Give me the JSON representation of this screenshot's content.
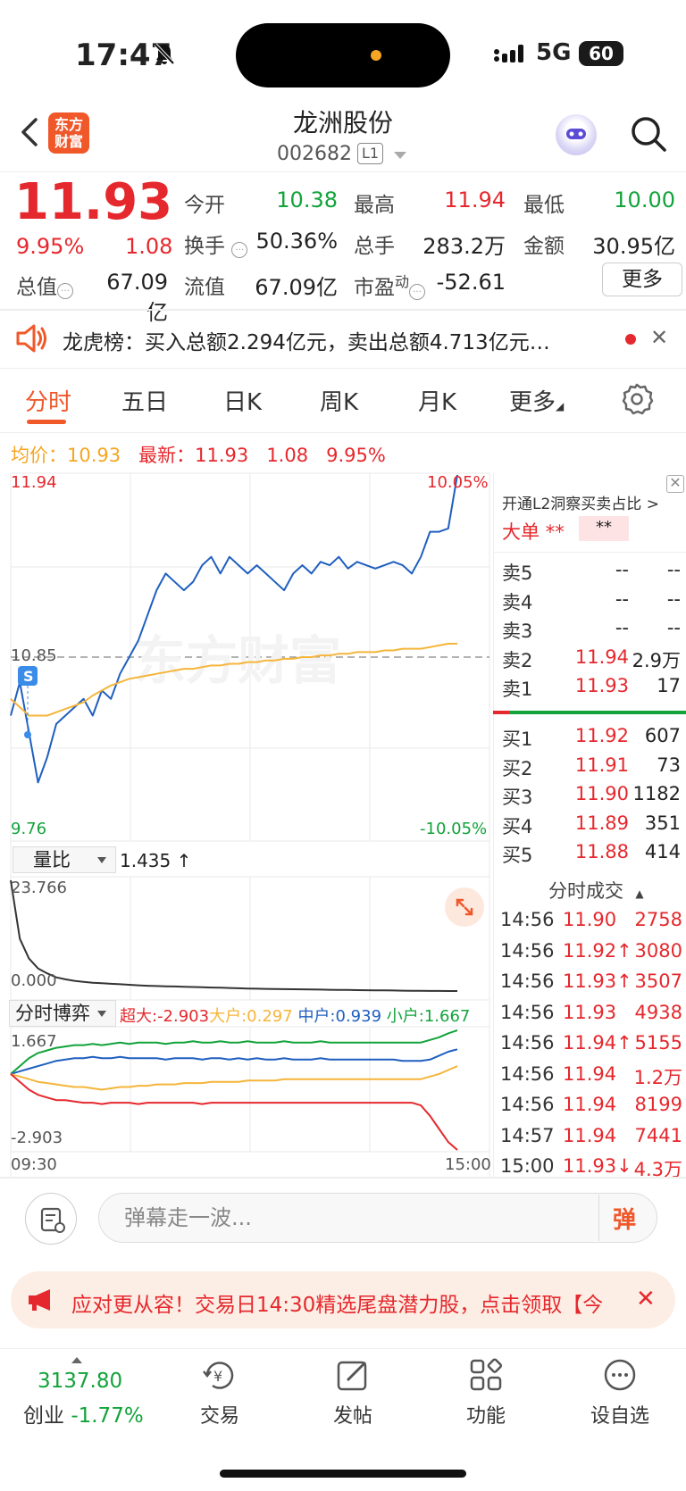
{
  "status": {
    "time": "17:47",
    "network": "5G",
    "battery": "60"
  },
  "header": {
    "logo": "东方\n财富",
    "title": "龙洲股份",
    "code": "002682",
    "level": "L1"
  },
  "quote": {
    "price": "11.93",
    "pct": "9.95%",
    "change": "1.08",
    "open_label": "今开",
    "open": "10.38",
    "high_label": "最高",
    "high": "11.94",
    "low_label": "最低",
    "low": "10.00",
    "turnover_label": "换手",
    "turnover": "50.36%",
    "volume_label": "总手",
    "volume": "283.2万",
    "amount_label": "金额",
    "amount": "30.95亿",
    "mktcap_label": "总值",
    "mktcap": "67.09亿",
    "float_label": "流值",
    "float": "67.09亿",
    "pe_label": "市盈",
    "pe_sup": "动",
    "pe": "-52.61",
    "more": "更多"
  },
  "news": {
    "text": "龙虎榜：买入总额2.294亿元，卖出总额4.713亿元…"
  },
  "tabs": [
    "分时",
    "五日",
    "日K",
    "周K",
    "月K",
    "更多"
  ],
  "chart_info": {
    "avg_label": "均价：",
    "avg": "10.93",
    "latest_label": "最新：",
    "latest": "11.93",
    "chg": "1.08",
    "pct": "9.95%"
  },
  "chart_data": [
    {
      "type": "line",
      "name": "intraday",
      "y_top": "11.94",
      "y_mid": "10.85",
      "y_bottom": "9.76",
      "pct_top": "10.05%",
      "pct_bottom": "-10.05%",
      "ylim": [
        9.76,
        11.94
      ],
      "series": [
        {
          "color": "#1f5fbf",
          "values": [
            10.5,
            10.7,
            10.4,
            10.1,
            10.25,
            10.45,
            10.5,
            10.55,
            10.6,
            10.5,
            10.65,
            10.6,
            10.75,
            10.85,
            10.95,
            11.1,
            11.25,
            11.35,
            11.3,
            11.25,
            11.3,
            11.4,
            11.45,
            11.35,
            11.45,
            11.4,
            11.35,
            11.4,
            11.35,
            11.3,
            11.25,
            11.35,
            11.4,
            11.35,
            11.42,
            11.4,
            11.45,
            11.38,
            11.42,
            11.4,
            11.38,
            11.4,
            11.42,
            11.4,
            11.35,
            11.45,
            11.6,
            11.6,
            11.62,
            11.94
          ]
        },
        {
          "color": "#f5b53a",
          "values": [
            10.6,
            10.55,
            10.5,
            10.5,
            10.5,
            10.52,
            10.54,
            10.56,
            10.58,
            10.62,
            10.65,
            10.68,
            10.7,
            10.72,
            10.73,
            10.74,
            10.75,
            10.76,
            10.77,
            10.78,
            10.78,
            10.79,
            10.8,
            10.8,
            10.81,
            10.81,
            10.82,
            10.82,
            10.83,
            10.83,
            10.84,
            10.84,
            10.85,
            10.85,
            10.86,
            10.86,
            10.87,
            10.87,
            10.88,
            10.88,
            10.88,
            10.89,
            10.89,
            10.9,
            10.9,
            10.9,
            10.91,
            10.92,
            10.93,
            10.93
          ]
        }
      ]
    },
    {
      "type": "line",
      "name": "volume_ratio",
      "label": "量比",
      "value": "1.435 ↑",
      "y_top": "23.766",
      "y_bottom": "0.000",
      "ylim": [
        0,
        23.766
      ],
      "series": [
        {
          "color": "#333333",
          "values": [
            23.766,
            12,
            8,
            6,
            5,
            4.2,
            3.8,
            3.5,
            3.3,
            3.1,
            3.0,
            2.9,
            2.8,
            2.7,
            2.6,
            2.5,
            2.45,
            2.4,
            2.35,
            2.3,
            2.25,
            2.2,
            2.15,
            2.1,
            2.05,
            2.0,
            1.95,
            1.9,
            1.88,
            1.85,
            1.82,
            1.8,
            1.78,
            1.75,
            1.72,
            1.7,
            1.68,
            1.65,
            1.62,
            1.6,
            1.58,
            1.56,
            1.54,
            1.52,
            1.5,
            1.48,
            1.46,
            1.45,
            1.44,
            1.435
          ]
        }
      ]
    },
    {
      "type": "line",
      "name": "fund_flow",
      "label": "分时博弈",
      "y_top": "1.667",
      "y_bottom": "-2.903",
      "x_start": "09:30",
      "x_end": "15:00",
      "ylim": [
        -2.903,
        1.667
      ],
      "legend": [
        {
          "label": "超大:-2.903",
          "color": "#e5282d"
        },
        {
          "label": "大户:0.297",
          "color": "#f5b53a"
        },
        {
          "label": "中户:0.939",
          "color": "#1f5fbf"
        },
        {
          "label": "小户:1.667",
          "color": "#12a33a"
        }
      ],
      "series": [
        {
          "color": "#12a33a",
          "values": [
            0,
            0.3,
            0.6,
            0.8,
            0.9,
            1.0,
            1.05,
            1.1,
            1.1,
            1.15,
            1.1,
            1.15,
            1.2,
            1.15,
            1.2,
            1.2,
            1.2,
            1.15,
            1.2,
            1.2,
            1.25,
            1.2,
            1.2,
            1.25,
            1.2,
            1.2,
            1.25,
            1.2,
            1.2,
            1.2,
            1.25,
            1.2,
            1.2,
            1.2,
            1.25,
            1.2,
            1.2,
            1.2,
            1.2,
            1.2,
            1.2,
            1.2,
            1.2,
            1.2,
            1.2,
            1.2,
            1.3,
            1.4,
            1.55,
            1.667
          ]
        },
        {
          "color": "#1f5fbf",
          "values": [
            0,
            0.1,
            0.2,
            0.3,
            0.4,
            0.5,
            0.55,
            0.6,
            0.6,
            0.65,
            0.6,
            0.6,
            0.65,
            0.6,
            0.6,
            0.6,
            0.6,
            0.55,
            0.6,
            0.6,
            0.6,
            0.55,
            0.6,
            0.6,
            0.55,
            0.6,
            0.55,
            0.6,
            0.55,
            0.55,
            0.6,
            0.55,
            0.55,
            0.55,
            0.6,
            0.55,
            0.55,
            0.55,
            0.55,
            0.55,
            0.55,
            0.55,
            0.55,
            0.5,
            0.5,
            0.5,
            0.55,
            0.7,
            0.85,
            0.939
          ]
        },
        {
          "color": "#f5b53a",
          "values": [
            0,
            -0.1,
            -0.2,
            -0.3,
            -0.35,
            -0.4,
            -0.45,
            -0.5,
            -0.5,
            -0.55,
            -0.6,
            -0.55,
            -0.5,
            -0.5,
            -0.45,
            -0.45,
            -0.4,
            -0.4,
            -0.4,
            -0.35,
            -0.35,
            -0.35,
            -0.3,
            -0.3,
            -0.3,
            -0.3,
            -0.25,
            -0.25,
            -0.25,
            -0.25,
            -0.2,
            -0.2,
            -0.2,
            -0.2,
            -0.2,
            -0.2,
            -0.2,
            -0.2,
            -0.2,
            -0.2,
            -0.2,
            -0.2,
            -0.2,
            -0.2,
            -0.2,
            -0.2,
            -0.1,
            0.0,
            0.15,
            0.297
          ]
        },
        {
          "color": "#e5282d",
          "values": [
            0,
            -0.3,
            -0.6,
            -0.8,
            -0.9,
            -1.0,
            -1.0,
            -1.05,
            -1.1,
            -1.1,
            -1.15,
            -1.1,
            -1.1,
            -1.1,
            -1.15,
            -1.1,
            -1.1,
            -1.1,
            -1.1,
            -1.1,
            -1.1,
            -1.15,
            -1.1,
            -1.1,
            -1.1,
            -1.1,
            -1.1,
            -1.1,
            -1.1,
            -1.1,
            -1.1,
            -1.1,
            -1.1,
            -1.1,
            -1.1,
            -1.1,
            -1.1,
            -1.1,
            -1.1,
            -1.1,
            -1.1,
            -1.1,
            -1.1,
            -1.1,
            -1.1,
            -1.2,
            -1.6,
            -2.1,
            -2.6,
            -2.903
          ]
        }
      ]
    }
  ],
  "orderbook": {
    "head": "开通L2洞察买卖占比 >",
    "big_label": "大单",
    "big_a": "**",
    "big_b": "**",
    "asks": [
      {
        "label": "卖5",
        "price": "--",
        "vol": "--"
      },
      {
        "label": "卖4",
        "price": "--",
        "vol": "--"
      },
      {
        "label": "卖3",
        "price": "--",
        "vol": "--"
      },
      {
        "label": "卖2",
        "price": "11.94",
        "vol": "2.9万"
      },
      {
        "label": "卖1",
        "price": "11.93",
        "vol": "17"
      }
    ],
    "bids": [
      {
        "label": "买1",
        "price": "11.92",
        "vol": "607"
      },
      {
        "label": "买2",
        "price": "11.91",
        "vol": "73"
      },
      {
        "label": "买3",
        "price": "11.90",
        "vol": "1182"
      },
      {
        "label": "买4",
        "price": "11.89",
        "vol": "351"
      },
      {
        "label": "买5",
        "price": "11.88",
        "vol": "414"
      }
    ]
  },
  "ticks": {
    "head": "分时成交",
    "rows": [
      {
        "t": "14:56",
        "p": "11.90",
        "v": "2758"
      },
      {
        "t": "14:56",
        "p": "11.92↑",
        "v": "3080"
      },
      {
        "t": "14:56",
        "p": "11.93↑",
        "v": "3507"
      },
      {
        "t": "14:56",
        "p": "11.93",
        "v": "4938"
      },
      {
        "t": "14:56",
        "p": "11.94↑",
        "v": "5155"
      },
      {
        "t": "14:56",
        "p": "11.94",
        "v": "1.2万"
      },
      {
        "t": "14:56",
        "p": "11.94",
        "v": "8199"
      },
      {
        "t": "14:57",
        "p": "11.94",
        "v": "7441"
      },
      {
        "t": "15:00",
        "p": "11.93↓",
        "v": "4.3万"
      }
    ]
  },
  "danmaku": {
    "placeholder": "弹幕走一波...",
    "button": "弹"
  },
  "banner": {
    "text": "应对更从容！交易日14:30精选尾盘潜力股，点击领取【今"
  },
  "nav": {
    "index_value": "3137.80",
    "index_name": "创业",
    "index_pct": "-1.77%",
    "items": [
      "交易",
      "发帖",
      "功能",
      "设自选"
    ]
  }
}
